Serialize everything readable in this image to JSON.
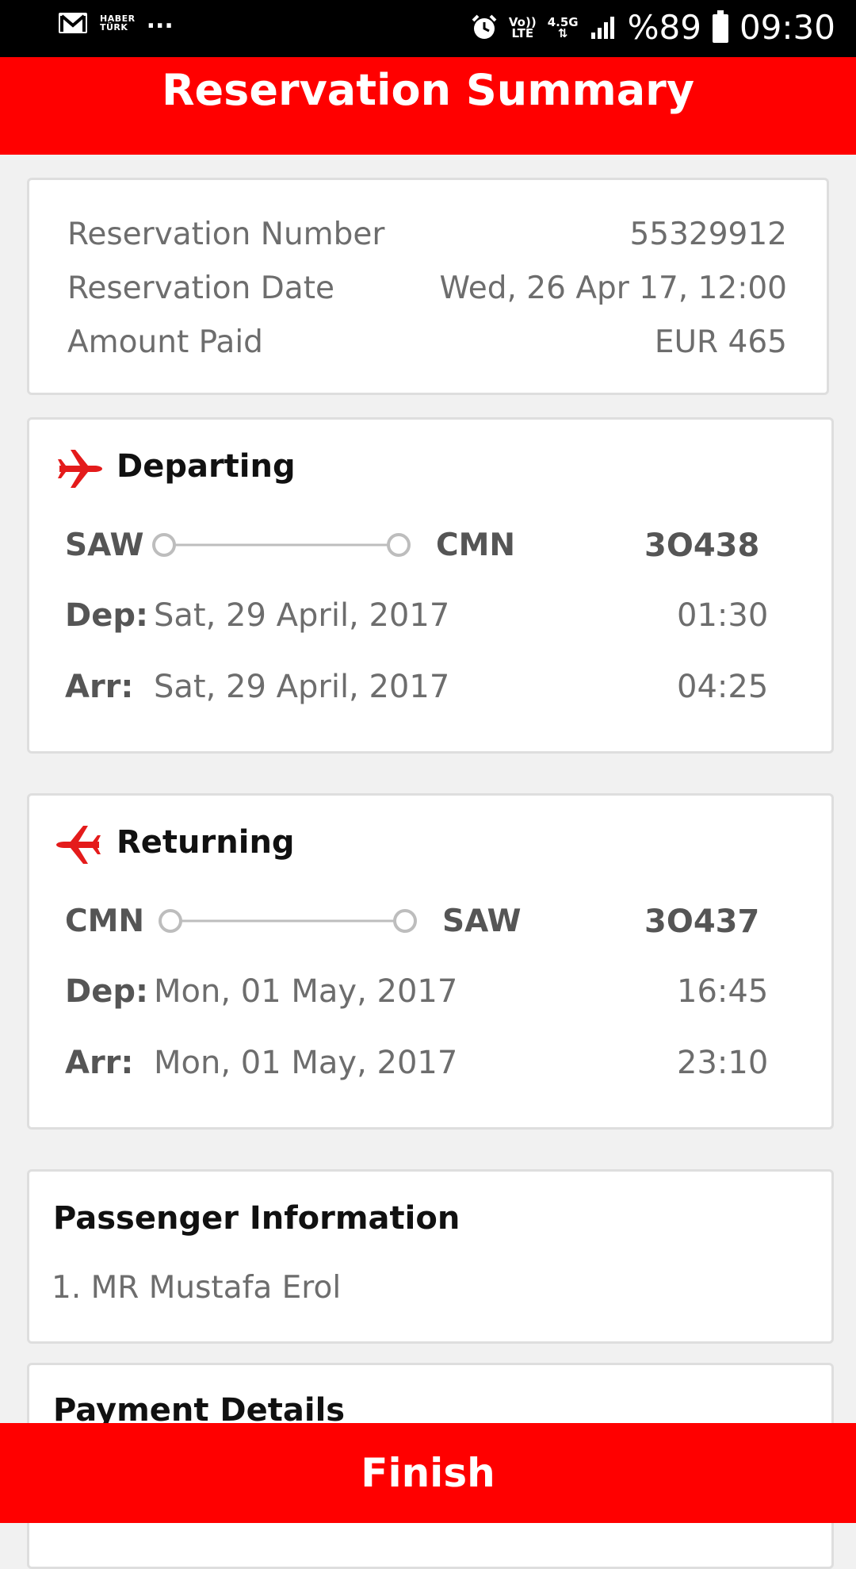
{
  "status_bar": {
    "haber_line1": "HABER",
    "haber_line2": "TÜRK",
    "dots": "...",
    "volte_line1": "Vo))",
    "volte_line2": "LTE",
    "net_line1": "4.5G",
    "net_line2": "⇅",
    "battery": "%89",
    "time": "09:30"
  },
  "header": {
    "title": "Reservation Summary"
  },
  "summary": {
    "rows": [
      {
        "label": "Reservation Number",
        "value": "55329912"
      },
      {
        "label": "Reservation Date",
        "value": "Wed, 26 Apr 17, 12:00"
      },
      {
        "label": "Amount Paid",
        "value": "EUR 465"
      }
    ]
  },
  "departing": {
    "title": "Departing",
    "from": "SAW",
    "to": "CMN",
    "flight_no": "3O438",
    "dep_label": "Dep:",
    "dep_date": "Sat, 29 April, 2017",
    "dep_time": "01:30",
    "arr_label": "Arr:",
    "arr_date": "Sat, 29 April, 2017",
    "arr_time": "04:25"
  },
  "returning": {
    "title": "Returning",
    "from": "CMN",
    "to": "SAW",
    "flight_no": "3O437",
    "dep_label": "Dep:",
    "dep_date": "Mon, 01 May, 2017",
    "dep_time": "16:45",
    "arr_label": "Arr:",
    "arr_date": "Mon, 01 May, 2017",
    "arr_time": "23:10"
  },
  "passenger": {
    "title": "Passenger Information",
    "items": [
      "1. MR Mustafa Erol"
    ]
  },
  "payment": {
    "title": "Payment Details"
  },
  "footer": {
    "finish_label": "Finish"
  },
  "colors": {
    "brand_red": "#ff0000",
    "text_gray": "#6d6d6d"
  },
  "icons": [
    "gmail-icon",
    "alarm-icon",
    "signal-icon",
    "battery-icon",
    "plane-depart-icon",
    "plane-return-icon"
  ]
}
